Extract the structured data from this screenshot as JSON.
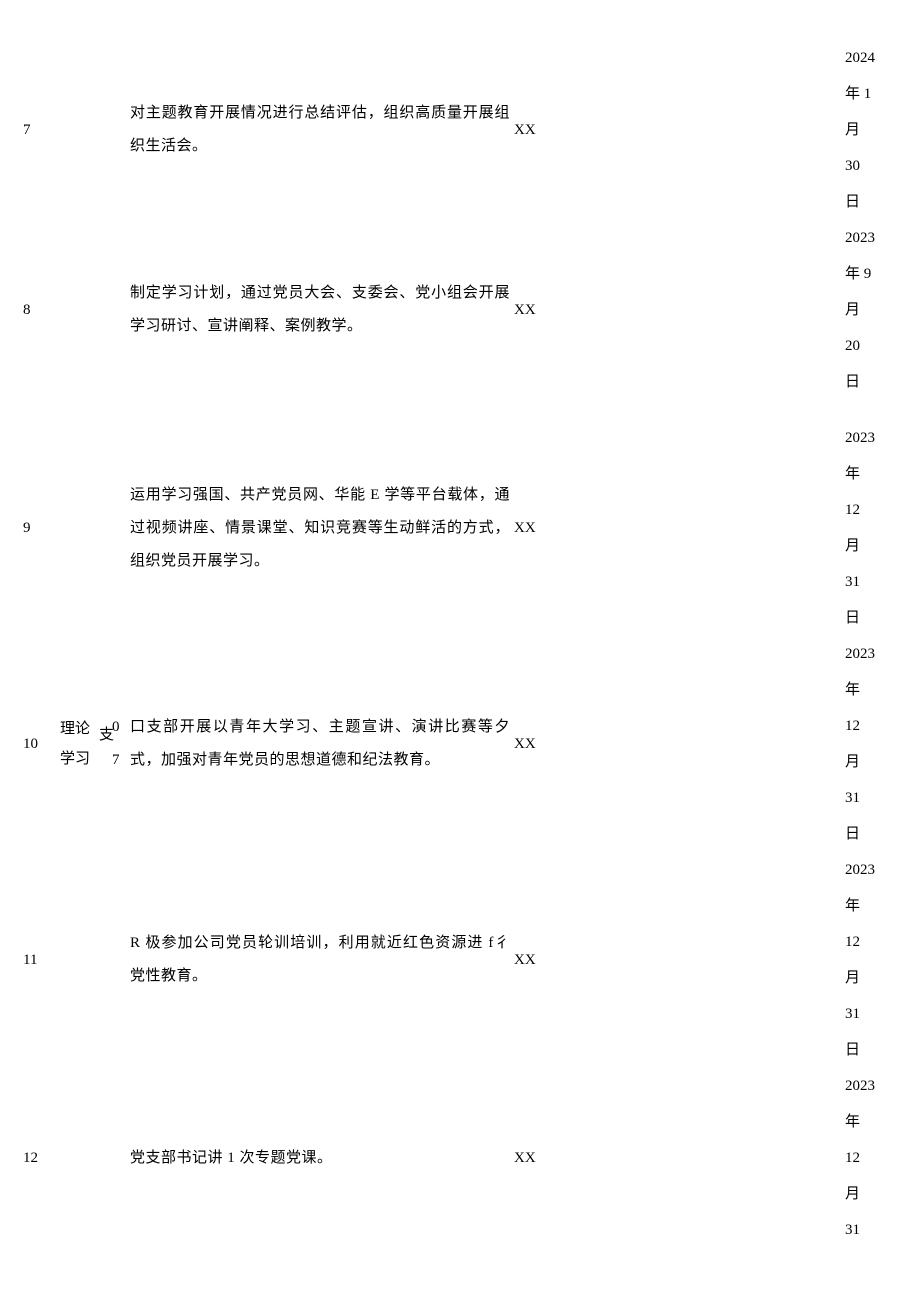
{
  "category": {
    "label": "理论\n学习"
  },
  "sub_category": {
    "label": "支\n0\n7"
  },
  "rows": [
    {
      "num": "7",
      "desc": "对主题教育开展情况进行总结评估，组织高质量开展组织生活会。",
      "resp": "XX",
      "date_lines": [
        "2024",
        "年 1",
        "月",
        "30",
        "日"
      ]
    },
    {
      "num": "8",
      "desc": "制定学习计划，通过党员大会、支委会、党小组会开展学习研讨、宣讲阐释、案例教学。",
      "resp": "XX",
      "date_lines": [
        "2023",
        "年 9",
        "月",
        "20",
        "日"
      ]
    },
    {
      "num": "9",
      "desc": "运用学习强国、共产党员网、华能 E 学等平台载体，通过视频讲座、情景课堂、知识竞赛等生动鲜活的方式，组织党员开展学习。",
      "resp": "XX",
      "date_lines": [
        "2023",
        "年",
        "12",
        "月",
        "31",
        "日"
      ]
    },
    {
      "num": "10",
      "desc": "口支部开展以青年大学习、主题宣讲、演讲比赛等夕式，加强对青年党员的思想道德和纪法教育。",
      "resp": "XX",
      "date_lines": [
        "2023",
        "年",
        "12",
        "月",
        "31",
        "日"
      ]
    },
    {
      "num": "11",
      "desc": "R 极参加公司党员轮训培训，利用就近红色资源进 f彳 党性教育。",
      "resp": "XX",
      "date_lines": [
        "2023",
        "年",
        "12",
        "月",
        "31",
        "日"
      ]
    },
    {
      "num": "12",
      "desc": "党支部书记讲 1 次专题党课。",
      "resp": "XX",
      "date_lines": [
        "2023",
        "年",
        "12",
        "月",
        "31"
      ]
    }
  ]
}
